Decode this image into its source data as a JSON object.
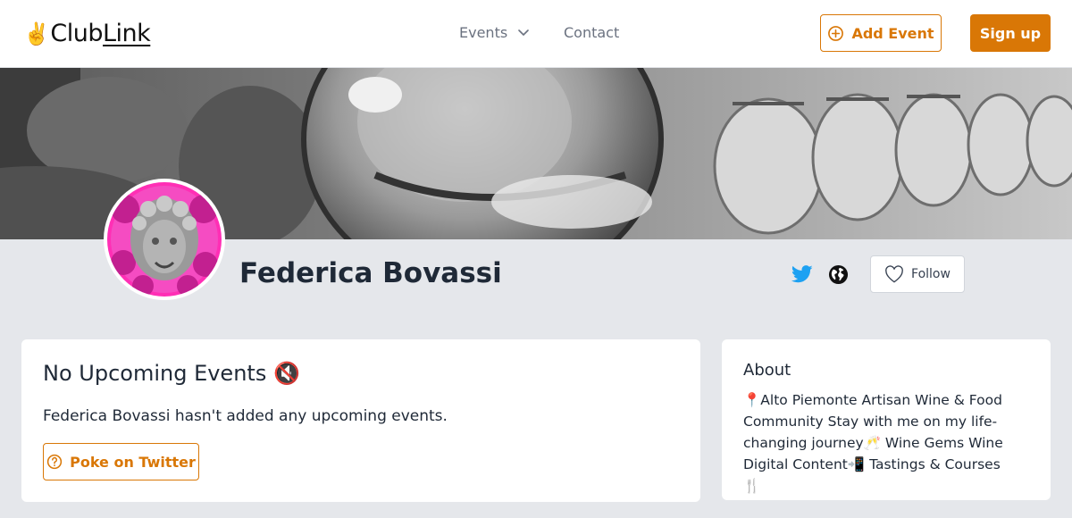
{
  "header": {
    "logo_hand": "✌️",
    "logo_club": "Club",
    "logo_link": "Link",
    "nav": {
      "events_label": "Events",
      "contact_label": "Contact"
    },
    "add_event_label": "Add Event",
    "sign_up_label": "Sign up"
  },
  "profile": {
    "name": "Federica Bovassi",
    "follow_label": "Follow"
  },
  "events_card": {
    "title": "No Upcoming Events",
    "title_emoji": "🔇",
    "message": "Federica Bovassi hasn't added any upcoming events.",
    "poke_label": "Poke on Twitter"
  },
  "about_card": {
    "title": "About",
    "text": "📍Alto Piemonte Artisan Wine & Food Community Stay with me on my life-changing journey🥂 Wine Gems Wine Digital Content📲 Tastings & Courses🍴"
  },
  "colors": {
    "accent": "#d97706",
    "page_bg": "#e5e7eb",
    "twitter": "#1da1f2",
    "avatar_pink": "#ff2fb5"
  },
  "icons": [
    "chevron-down-icon",
    "plus-circle-icon",
    "twitter-icon",
    "globe-icon",
    "heart-icon",
    "question-circle-icon"
  ]
}
